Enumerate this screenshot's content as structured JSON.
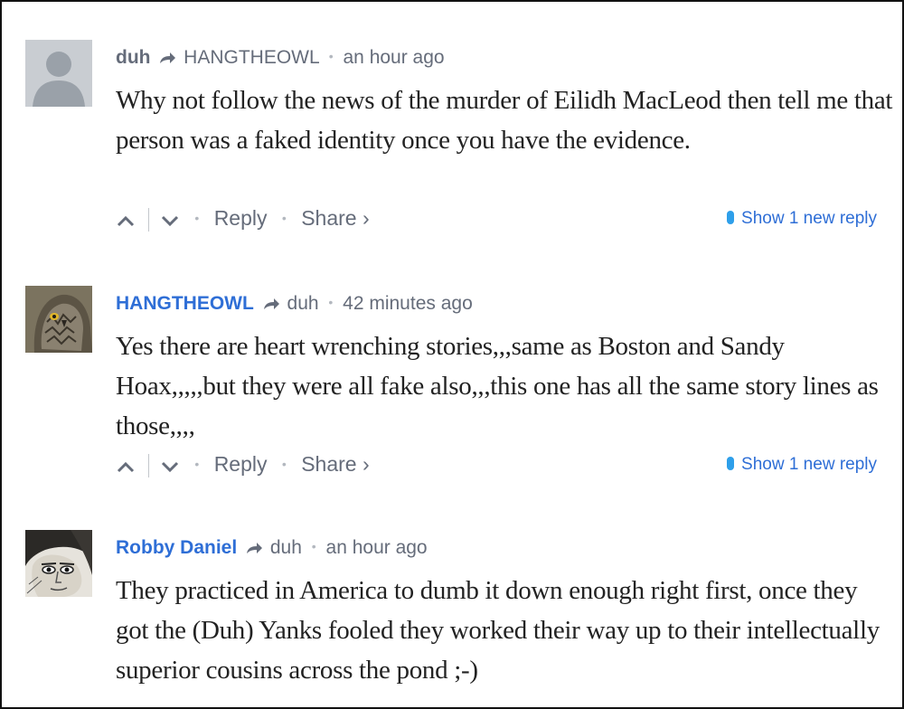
{
  "separators": {
    "dot": "•",
    "share_chevron": "›"
  },
  "comments": [
    {
      "author": "duh",
      "author_color": "#656c7a",
      "reply_to": "HANGTHEOWL",
      "time": "an hour ago",
      "text": "Why not follow the news of the murder of Eilidh MacLeod then tell me that person was a faked identity once you have the evidence.",
      "avatar": "default-avatar",
      "reply_label": "Reply",
      "share_label": "Share",
      "show_new": "Show 1 new reply"
    },
    {
      "author": "HANGTHEOWL",
      "author_color": "#2e6ed6",
      "reply_to": "duh",
      "time": "42 minutes ago",
      "text": "Yes there are heart wrenching stories,,,same as Boston and Sandy Hoax,,,,,but they were all fake also,,,this one has all the same story lines as those,,,,",
      "avatar": "owl-photo-avatar",
      "reply_label": "Reply",
      "share_label": "Share",
      "show_new": "Show 1 new reply"
    },
    {
      "author": "Robby Daniel",
      "author_color": "#2e6ed6",
      "reply_to": "duh",
      "time": "an hour ago",
      "text": "They practiced in America to dumb it down enough right first, once they got the (Duh) Yanks fooled they worked their way up to their intellectually superior cousins across the pond ;-)",
      "avatar": "sketch-portrait-avatar"
    }
  ]
}
